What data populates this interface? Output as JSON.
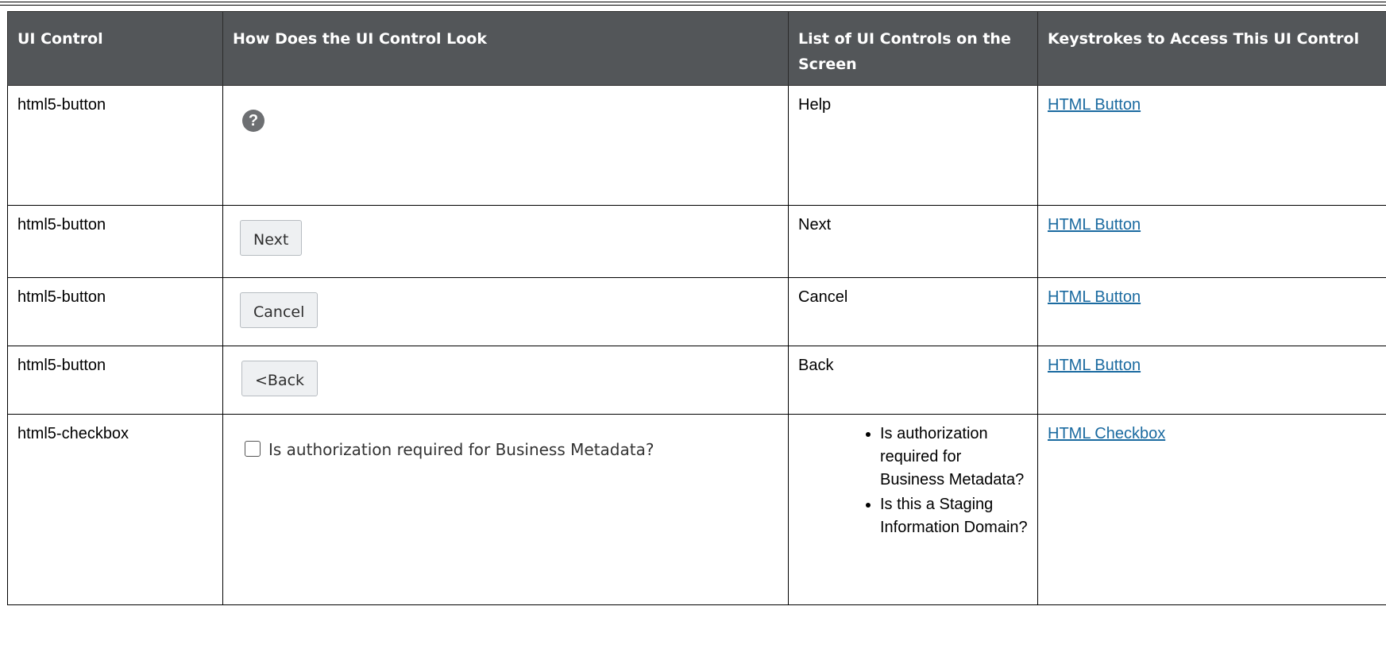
{
  "headers": [
    "UI Control",
    "How Does the UI Control Look",
    "List of UI Controls on the Screen",
    "Keystrokes to Access This UI Control"
  ],
  "rows": [
    {
      "control": "html5-button",
      "look_type": "help-icon",
      "look_text": "?",
      "list": [
        "Help"
      ],
      "link": "HTML Button"
    },
    {
      "control": "html5-button",
      "look_type": "button",
      "look_text": "Next",
      "list": [
        "Next"
      ],
      "link": "HTML Button"
    },
    {
      "control": "html5-button",
      "look_type": "button",
      "look_text": "Cancel",
      "list": [
        "Cancel"
      ],
      "link": "HTML Button"
    },
    {
      "control": "html5-button",
      "look_type": "button",
      "look_text": "<Back",
      "list": [
        "Back"
      ],
      "link": "HTML Button"
    },
    {
      "control": "html5-checkbox",
      "look_type": "checkbox",
      "look_text": "Is authorization required for Business Metadata?",
      "list": [
        "Is authorization required for Business Metadata?",
        " Is this a Staging Information Domain?"
      ],
      "link": "HTML Checkbox"
    }
  ],
  "colors": {
    "header_bg": "#535659",
    "link": "#1a6aa0"
  }
}
